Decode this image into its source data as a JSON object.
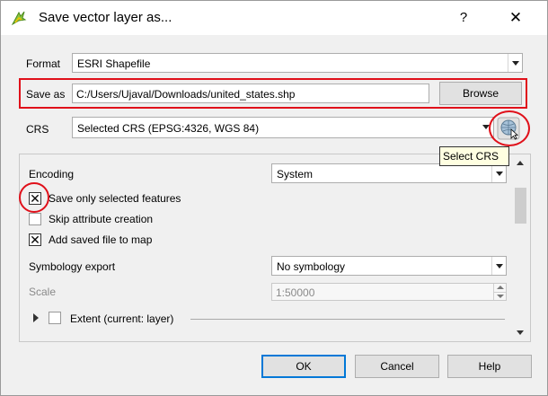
{
  "window": {
    "title": "Save vector layer as...",
    "help_symbol": "?",
    "close_symbol": "✕"
  },
  "form": {
    "format_label": "Format",
    "format_value": "ESRI Shapefile",
    "save_as_label": "Save as",
    "save_as_value": "C:/Users/Ujaval/Downloads/united_states.shp",
    "browse_label": "Browse",
    "crs_label": "CRS",
    "crs_value": "Selected CRS (EPSG:4326, WGS 84)",
    "crs_tooltip": "Select CRS"
  },
  "options": {
    "encoding_label": "Encoding",
    "encoding_value": "System",
    "save_selected_label": "Save only selected features",
    "save_selected_checked": true,
    "skip_attr_label": "Skip attribute creation",
    "skip_attr_checked": false,
    "add_saved_label": "Add saved file to map",
    "add_saved_checked": true,
    "symbology_label": "Symbology export",
    "symbology_value": "No symbology",
    "scale_label": "Scale",
    "scale_value": "1:50000",
    "extent_label": "Extent (current: layer)"
  },
  "buttons": {
    "ok": "OK",
    "cancel": "Cancel",
    "help": "Help"
  },
  "colors": {
    "annotation_red": "#e0101a",
    "default_button_border": "#0078d7",
    "tooltip_bg": "#ffffe1"
  }
}
